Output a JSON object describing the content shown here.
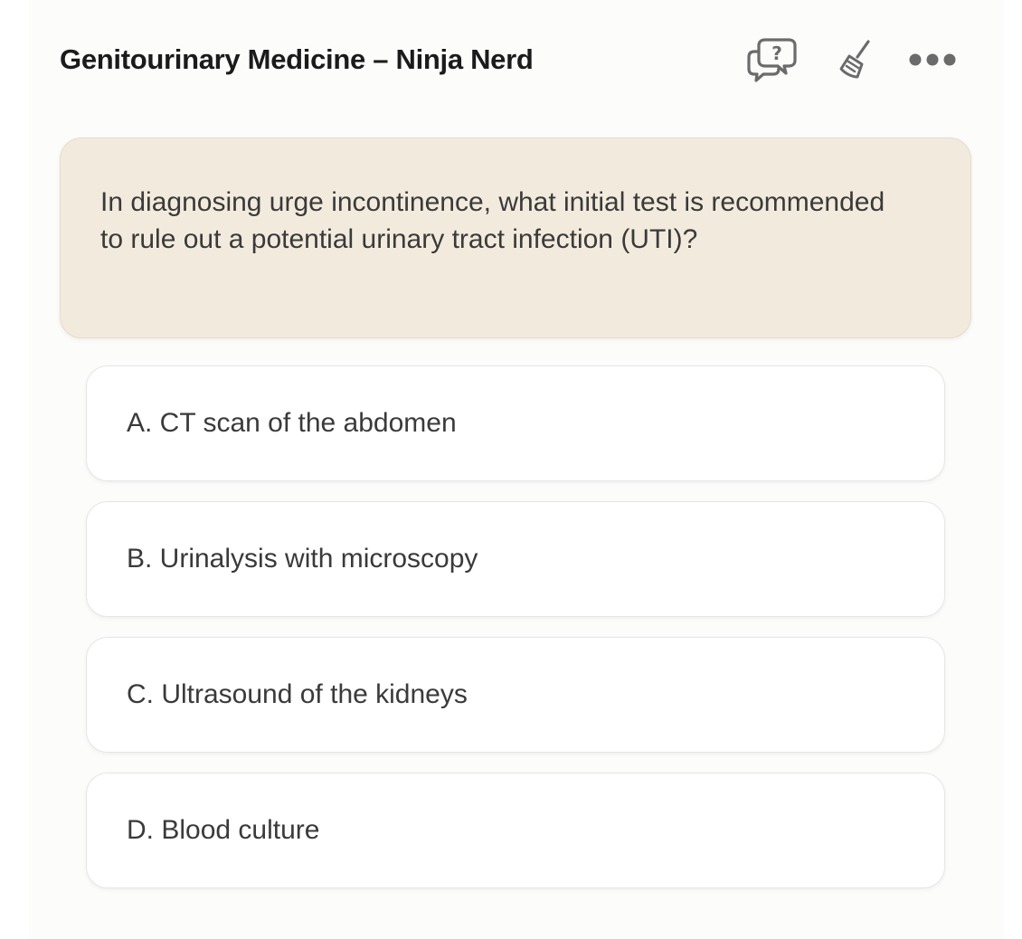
{
  "header": {
    "title": "Genitourinary Medicine – Ninja Nerd",
    "icons": {
      "help": "help-chat-icon",
      "clear": "broom-icon",
      "more": "more-horizontal-icon"
    }
  },
  "question": {
    "text": "In diagnosing urge incontinence, what initial test is recommended to rule out a potential urinary tract infection (UTI)?"
  },
  "options": [
    {
      "label": "A. CT scan of the abdomen"
    },
    {
      "label": "B. Urinalysis with microscopy"
    },
    {
      "label": "C. Ultrasound of the kidneys"
    },
    {
      "label": "D. Blood culture"
    }
  ],
  "colors": {
    "icon": "#6b6b6b",
    "question_bg": "#f2ebdd",
    "option_bg": "#ffffff",
    "text": "#3a3a3a"
  }
}
